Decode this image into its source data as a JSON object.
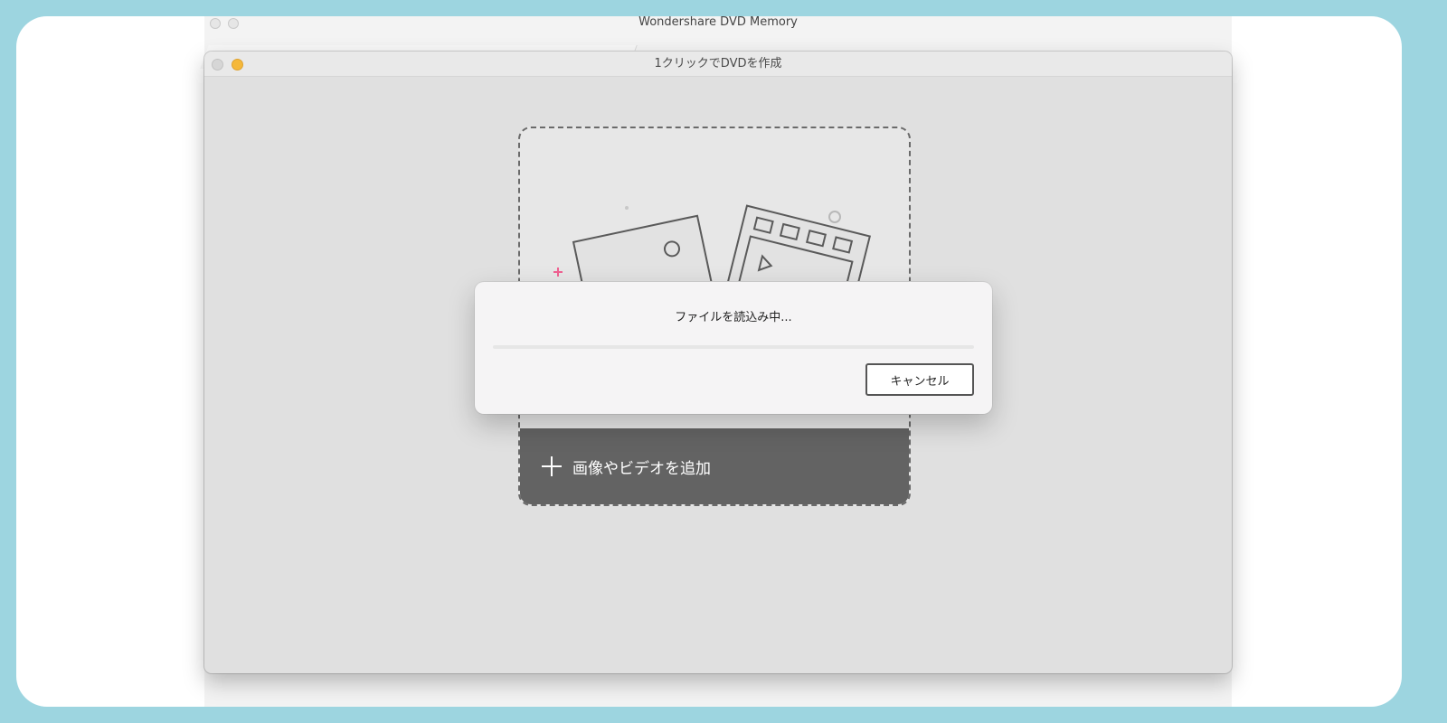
{
  "main_window": {
    "title": "Wondershare DVD Memory"
  },
  "modal_window": {
    "title": "1クリックでDVDを作成"
  },
  "drop_zone": {
    "add_label": "画像やビデオを追加"
  },
  "loading_dialog": {
    "message": "ファイルを読込み中...",
    "progress": 0.0,
    "cancel_label": "キャンセル"
  },
  "colors": {
    "outer_border": "#9dd5e0",
    "minimize_button": "#f5b83a",
    "add_bar": "#636363",
    "accent_pink": "#f06292"
  }
}
